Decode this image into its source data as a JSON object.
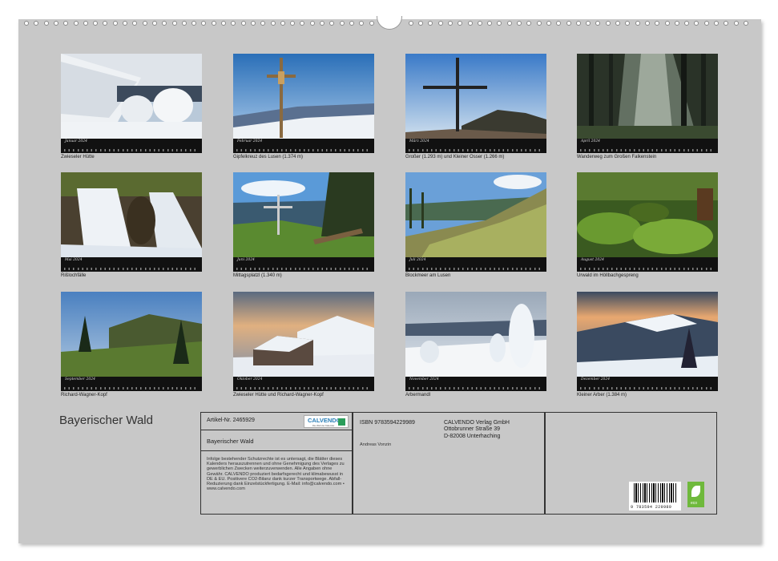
{
  "document": {
    "title": "Bayerischer Wald"
  },
  "months": [
    {
      "month": "Januar 2024",
      "caption": "Zwieseler Hütte"
    },
    {
      "month": "Februar 2024",
      "caption": "Gipfelkreuz des Lusen (1.374 m)"
    },
    {
      "month": "März 2024",
      "caption": "Großer (1.293 m) und Kleiner Osser (1.266 m)"
    },
    {
      "month": "April 2024",
      "caption": "Wanderweg zum Großen Falkenstein"
    },
    {
      "month": "Mai 2024",
      "caption": "Rißlochfälle"
    },
    {
      "month": "Juni 2024",
      "caption": "Mittagsplatzl (1.340 m)"
    },
    {
      "month": "Juli 2024",
      "caption": "Blockmeer am Lusen"
    },
    {
      "month": "August 2024",
      "caption": "Urwald im Höllbachgespreng"
    },
    {
      "month": "September 2024",
      "caption": "Richard-Wagner-Kopf"
    },
    {
      "month": "Oktober 2024",
      "caption": "Zwieseler Hütte und Richard-Wagner-Kopf"
    },
    {
      "month": "November 2024",
      "caption": "Arbermandl"
    },
    {
      "month": "Dezember 2024",
      "caption": "Kleiner Arber (1.384 m)"
    }
  ],
  "info": {
    "article_number": "Artikel-Nr. 2465929",
    "logo": "CALVENDO",
    "logo_tagline": "Die Welt der Kalender",
    "subtitle": "Bayerischer Wald",
    "legal": "Infolge bestehender Schutzrechte ist es untersagt, die Blätter dieses Kalenders herauszutrennen und ohne Genehmigung des Verlages zu gewerblichen Zwecken weiterzuverwenden. Alle Angaben ohne Gewähr. CALVENDO produziert bedarfsgerecht und klimabewusst in DE & EU. Positivere CO2-Bilanz dank kurzer Transportwege. Abfall-Reduzierung dank Einzelstückfertigung. E-Mail: info@calvendo.com • www.calvendo.com",
    "isbn": "ISBN 9783594229989",
    "publisher_name": "CALVENDO Verlag GmbH",
    "publisher_street": "Ottobrunner Straße 39",
    "publisher_city": "D-82008 Unterhaching",
    "author": "Andreas Vonzin",
    "barcode_number": "9 783594 229989",
    "eco_label": "eco"
  },
  "colors": {
    "sheet": "#c8c8c8",
    "calendar_bar": "#111111",
    "eco_green": "#6fb93c",
    "calvendo_blue": "#2a7fb8"
  }
}
